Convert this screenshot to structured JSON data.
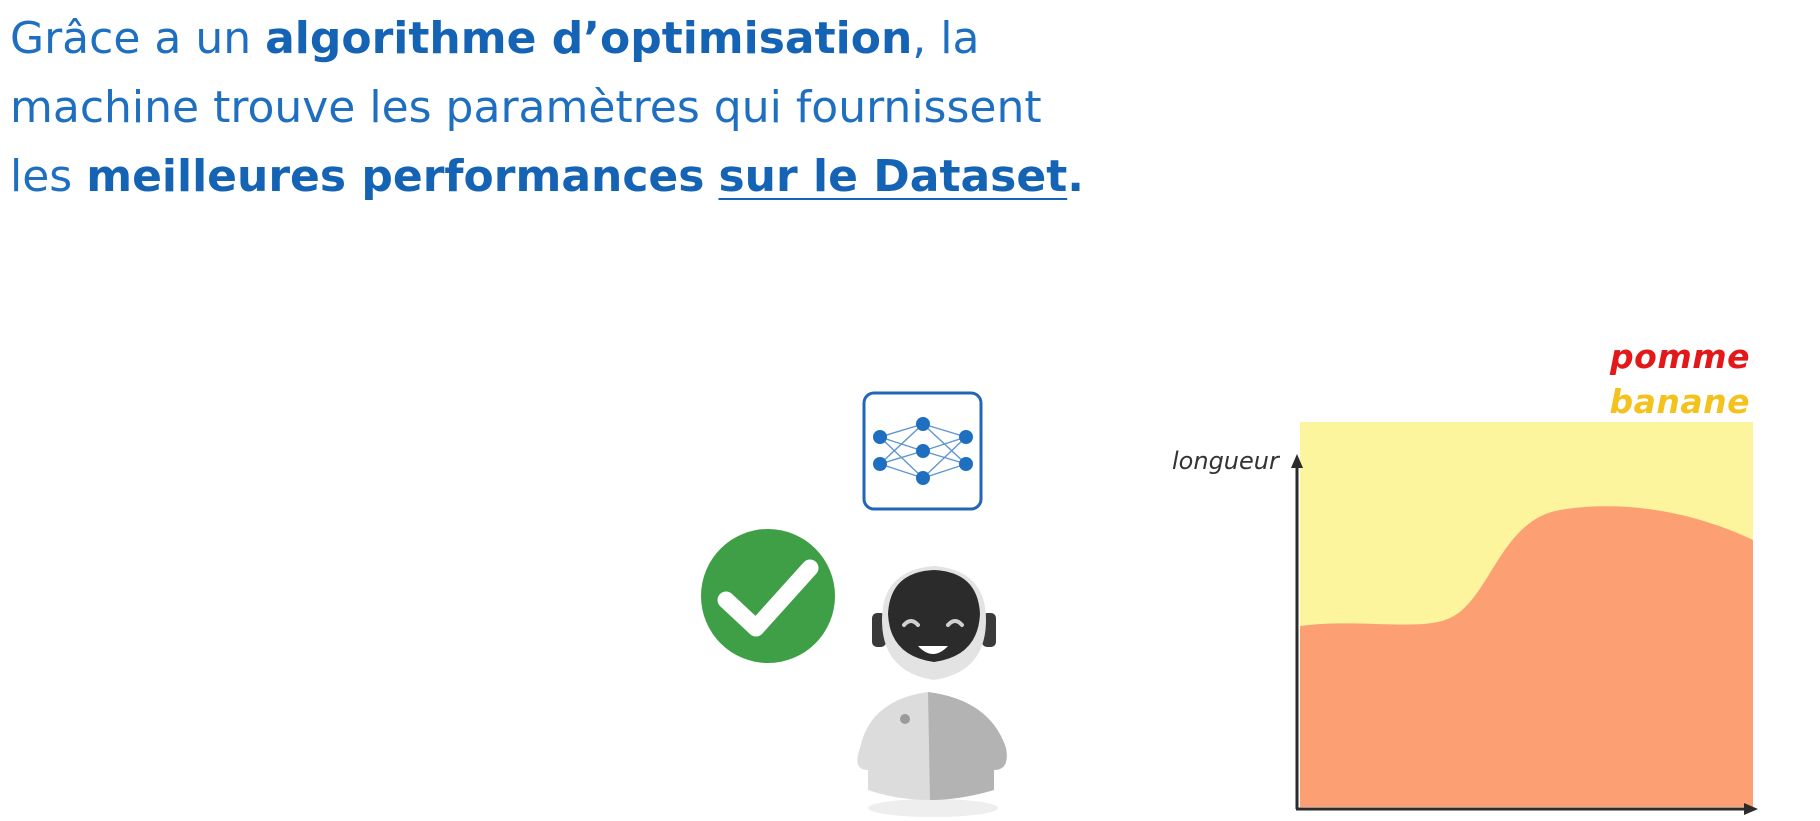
{
  "heading": {
    "line1": {
      "prefix": "Grâce a un ",
      "bold": "algorithme d’optimisation",
      "suffix": ", la"
    },
    "line2": {
      "text": "machine trouve les paramètres qui fournissent"
    },
    "line3": {
      "prefix": "les ",
      "bold": "meilleures performances",
      "space": " ",
      "underline": "sur le Dataset",
      "suffix": "."
    }
  },
  "chart": {
    "axis_label": "longueur",
    "legend": [
      {
        "label": "pomme",
        "color": "#e31818"
      },
      {
        "label": "banane",
        "color": "#f4c21d"
      }
    ],
    "region_colors": {
      "banane": "#fdf49e",
      "pomme": "#fca073"
    }
  },
  "icons": {
    "network": "neural-network-icon",
    "check": "checkmark-icon",
    "robot": "robot-icon"
  },
  "colors": {
    "heading": "#1f6fc0",
    "check_green": "#3e9f47",
    "network_blue": "#1f6fc0"
  }
}
